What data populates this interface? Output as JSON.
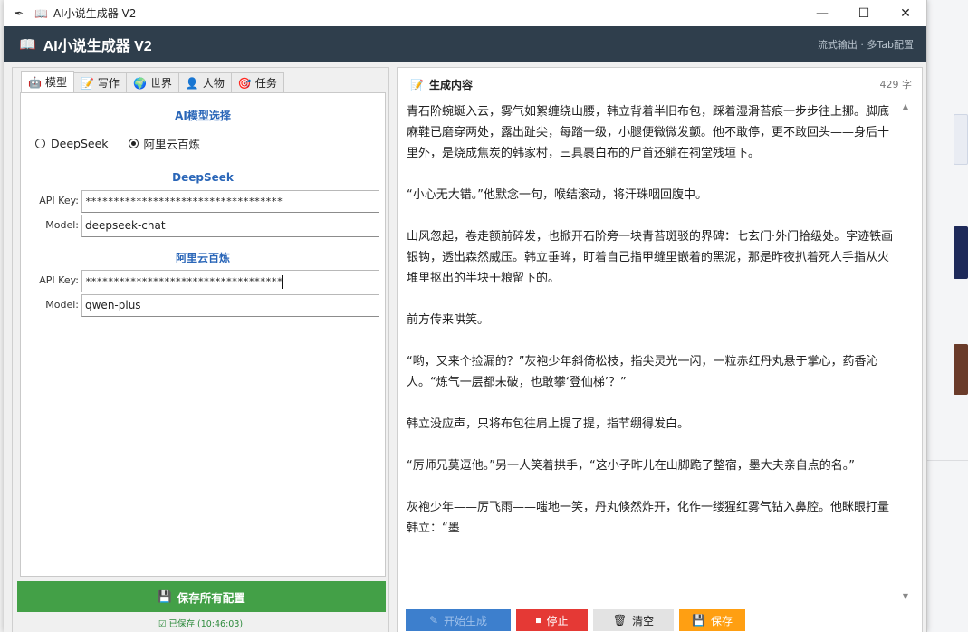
{
  "window": {
    "title": "AI小说生成器 V2",
    "minimize": "—",
    "maximize": "☐",
    "close": "✕"
  },
  "header": {
    "title": "AI小说生成器 V2",
    "tagline": "流式输出 · 多Tab配置"
  },
  "tabs": [
    {
      "label": "模型",
      "icon": "robot-icon"
    },
    {
      "label": "写作",
      "icon": "edit-icon"
    },
    {
      "label": "世界",
      "icon": "globe-icon"
    },
    {
      "label": "人物",
      "icon": "person-icon"
    },
    {
      "label": "任务",
      "icon": "target-icon"
    }
  ],
  "model_tab": {
    "section_title": "AI模型选择",
    "options": [
      {
        "label": "DeepSeek",
        "selected": false
      },
      {
        "label": "阿里云百炼",
        "selected": true
      }
    ],
    "deepseek": {
      "title": "DeepSeek",
      "api_key_label": "API Key:",
      "api_key_value": "***********************************",
      "model_label": "Model:",
      "model_value": "deepseek-chat"
    },
    "aliyun": {
      "title": "阿里云百炼",
      "api_key_label": "API Key:",
      "api_key_value": "***********************************",
      "model_label": "Model:",
      "model_value": "qwen-plus"
    }
  },
  "save_all": {
    "label": "保存所有配置",
    "status": "已保存 (10:46:03)"
  },
  "output": {
    "title": "生成内容",
    "count": "429 字",
    "paragraphs": [
      "青石阶蜿蜒入云，雾气如絮缠绕山腰，韩立背着半旧布包，踩着湿滑苔痕一步步往上挪。脚底麻鞋已磨穿两处，露出趾尖，每踏一级，小腿便微微发颤。他不敢停，更不敢回头——身后十里外，是烧成焦炭的韩家村，三具裹白布的尸首还躺在祠堂残垣下。",
      "“小心无大错。”他默念一句，喉结滚动，将汗珠咽回腹中。",
      "山风忽起，卷走额前碎发，也掀开石阶旁一块青苔斑驳的界碑：七玄门·外门拾级处。字迹铁画银钩，透出森然威压。韩立垂眸，盯着自己指甲缝里嵌着的黑泥，那是昨夜扒着死人手指从火堆里抠出的半块干粮留下的。",
      "前方传来哄笑。",
      "“哟，又来个捡漏的？”灰袍少年斜倚松枝，指尖灵光一闪，一粒赤红丹丸悬于掌心，药香沁人。“炼气一层都未破，也敢攀‘登仙梯’？”",
      "韩立没应声，只将布包往肩上提了提，指节绷得发白。",
      "“厉师兄莫逗他。”另一人笑着拱手，“这小子昨儿在山脚跪了整宿，墨大夫亲自点的名。”",
      "灰袍少年——厉飞雨——嗤地一笑，丹丸倏然炸开，化作一缕猩红雾气钻入鼻腔。他眯眼打量韩立：“墨"
    ]
  },
  "actions": {
    "start": "开始生成",
    "stop": "停止",
    "clear": "清空",
    "save": "保存"
  }
}
